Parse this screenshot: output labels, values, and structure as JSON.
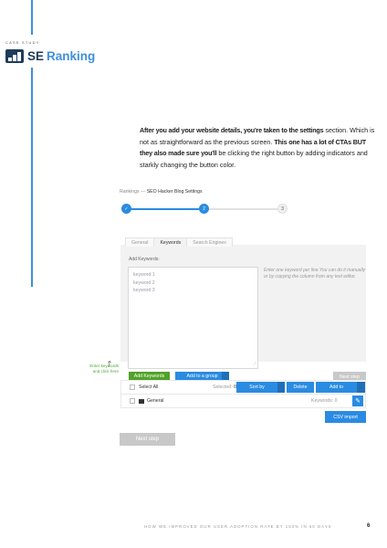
{
  "header": {
    "case_study": "CASE STUDY",
    "brand_se": "SE",
    "brand_ranking": "Ranking"
  },
  "paragraph": {
    "bold1": "After you add your website details, you're taken to the settings",
    "normal1": " section. Which is not as straightforward as the previous screen. ",
    "bold2": "This one has a lot of CTAs BUT they also made sure you'll",
    "normal2": " be clicking the right button by adding indicators and starkly changing the button color."
  },
  "app": {
    "breadcrumb_root": "Rankings —",
    "breadcrumb_page": "SEO Hacker Blog Settings",
    "steps": [
      "✓",
      "2",
      "3"
    ],
    "tabs": [
      "General",
      "Keywords",
      "Search Engines"
    ],
    "active_tab": "Keywords",
    "add_keywords_label": "Add Keywords:",
    "keyword_placeholders": [
      "keyword 1",
      "keyword 2",
      "keyword 3"
    ],
    "hint": "Enter one keyword per line.You can do it manually or by copying the column from any text editor.",
    "add_keywords_button": "Add Keywords",
    "add_to_group_button": "Add to a group",
    "next_step_small": "Next step",
    "select_all": "Select All",
    "selected_label": "Selected:",
    "selected_count": "0",
    "sort_by": "Sort by",
    "delete": "Delete",
    "add_to": "Add to",
    "group_name": "General",
    "keywords_label": "Keywords:",
    "keywords_count": "0",
    "csv_import": "CSV import",
    "next_step": "Next step"
  },
  "annotation": {
    "line1": "Enter keywords",
    "line2": "and click here"
  },
  "footer": {
    "text": "HOW WE IMPROVED OUR USER ADOPTION RATE BY 150% IN 60 DAYS",
    "page_number": "6"
  },
  "colors": {
    "accent_blue": "#2a8be2",
    "brand_navy": "#1f3b5b",
    "green": "#51a229"
  }
}
